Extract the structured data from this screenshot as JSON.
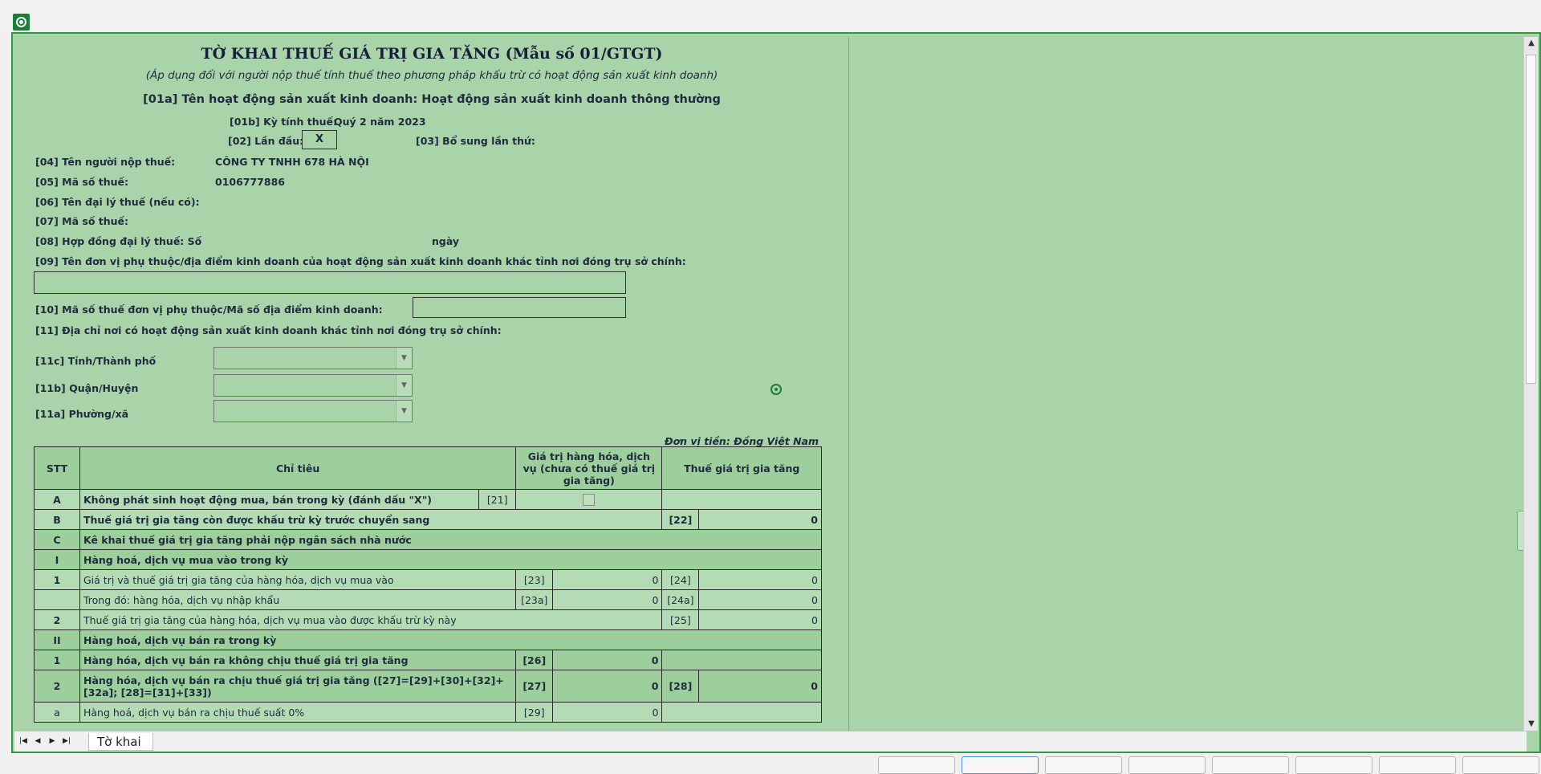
{
  "form": {
    "title": "TỜ KHAI THUẾ GIÁ TRỊ GIA TĂNG (Mẫu số 01/GTGT)",
    "subtitle": "(Áp dụng đối với người nộp thuế tính thuế theo phương pháp khấu trừ có hoạt động sản xuất kinh doanh)",
    "line_01a": "[01a] Tên hoạt động sản xuất kinh doanh: Hoạt động sản xuất kinh doanh thông thường",
    "label_01b": "[01b] Kỳ tính thuế:",
    "value_01b": "Quý 2 năm 2023",
    "label_02": "[02] Lần đầu:",
    "value_02": "X",
    "label_03": "[03] Bổ sung lần thứ:",
    "label_04": "[04] Tên người nộp thuế:",
    "value_04": "CÔNG TY TNHH 678 HÀ NỘI",
    "label_05": "[05] Mã số thuế:",
    "value_05": "0106777886",
    "label_06": "[06] Tên đại lý thuế (nếu có):",
    "label_07": "[07] Mã số thuế:",
    "label_08": "[08] Hợp đồng đại lý thuế: Số",
    "label_08_date": "ngày",
    "label_09": "[09] Tên đơn vị phụ thuộc/địa điểm kinh doanh của hoạt động sản xuất kinh doanh khác tỉnh nơi đóng trụ sở chính:",
    "label_10": "[10] Mã số thuế đơn vị phụ thuộc/Mã số địa điểm kinh doanh:",
    "label_11": "[11] Địa chỉ nơi có hoạt động sản xuất kinh doanh khác tỉnh nơi đóng trụ sở chính:",
    "label_11c": "[11c] Tỉnh/Thành phố",
    "label_11b": "[11b] Quận/Huyện",
    "label_11a": "[11a] Phường/xã",
    "currency_unit": "Đơn vị tiền: Đồng Việt Nam"
  },
  "table": {
    "headers": {
      "stt": "STT",
      "chi_tieu": "Chỉ tiêu",
      "gia_tri": "Giá trị hàng hóa, dịch vụ (chưa có thuế giá trị gia tăng)",
      "thue": "Thuế giá trị gia tăng"
    },
    "rows": [
      {
        "stt": "A",
        "text": "Không phát sinh hoạt động mua, bán trong kỳ (đánh dấu \"X\")",
        "code1": "[21]"
      },
      {
        "stt": "B",
        "text": "Thuế giá trị gia tăng còn được khấu trừ kỳ trước chuyển sang",
        "code2": "[22]",
        "val2": "0"
      },
      {
        "stt": "C",
        "text": "Kê khai thuế giá trị gia tăng phải nộp ngân sách nhà nước"
      },
      {
        "stt": "I",
        "text": "Hàng hoá, dịch vụ mua vào trong kỳ"
      },
      {
        "stt": "1",
        "text": "Giá trị và thuế giá trị gia tăng của hàng hóa, dịch vụ mua vào",
        "code1": "[23]",
        "val1": "0",
        "code2": "[24]",
        "val2": "0"
      },
      {
        "stt": "",
        "text": "Trong đó: hàng hóa, dịch vụ nhập khẩu",
        "code1": "[23a]",
        "val1": "0",
        "code2": "[24a]",
        "val2": "0"
      },
      {
        "stt": "2",
        "text": "Thuế giá trị gia tăng của hàng hóa, dịch vụ mua vào được khấu trừ kỳ này",
        "code2": "[25]",
        "val2": "0"
      },
      {
        "stt": "II",
        "text": "Hàng hoá, dịch vụ bán ra trong kỳ"
      },
      {
        "stt": "1",
        "text": "Hàng hóa, dịch vụ bán ra không chịu thuế giá trị gia tăng",
        "code1": "[26]",
        "val1": "0"
      },
      {
        "stt": "2",
        "text": "Hàng hóa, dịch vụ bán ra chịu thuế giá trị gia tăng ([27]=[29]+[30]+[32]+[32a]; [28]=[31]+[33])",
        "code1": "[27]",
        "val1": "0",
        "code2": "[28]",
        "val2": "0"
      },
      {
        "stt": "a",
        "text": "Hàng hoá, dịch vụ bán ra chịu thuế suất 0%",
        "code1": "[29]",
        "val1": "0"
      }
    ]
  },
  "sheet_tab": "Tờ khai",
  "colors": {
    "form_bg": "#a9d3a9",
    "frame_border": "#2f9a45",
    "header_bg": "#9ccf9c"
  }
}
